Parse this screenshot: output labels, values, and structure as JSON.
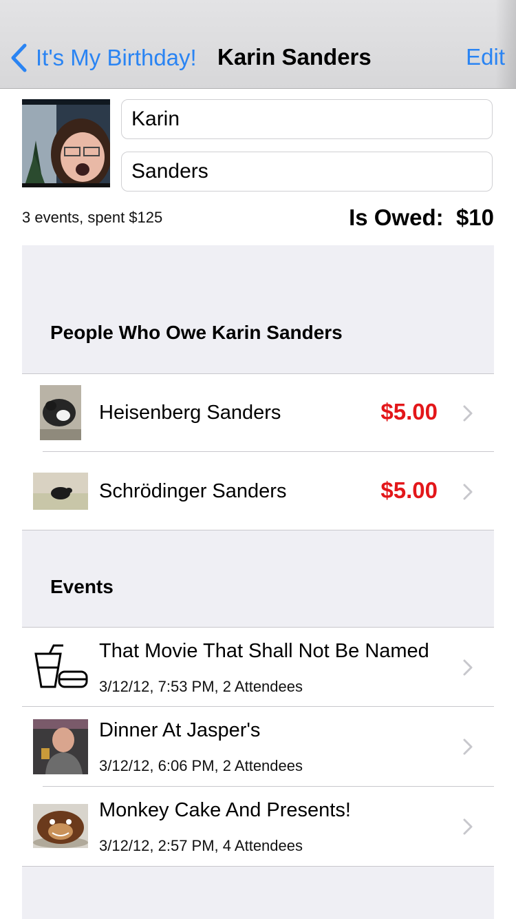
{
  "nav": {
    "back_label": "It's My Birthday!",
    "title": "Karin Sanders",
    "edit_label": "Edit"
  },
  "profile": {
    "first_name": "Karin",
    "last_name": "Sanders",
    "summary": "3 events, spent $125",
    "owed_label": "Is Owed:",
    "owed_amount": "$10"
  },
  "owe_section": {
    "header": "People Who Owe Karin Sanders",
    "people": [
      {
        "name": "Heisenberg Sanders",
        "amount": "$5.00"
      },
      {
        "name": "Schrödinger Sanders",
        "amount": "$5.00"
      }
    ]
  },
  "events_section": {
    "header": "Events",
    "events": [
      {
        "title": "That Movie That Shall Not Be Named",
        "details": "3/12/12, 7:53 PM, 2 Attendees"
      },
      {
        "title": "Dinner At Jasper's",
        "details": "3/12/12, 6:06 PM, 2 Attendees"
      },
      {
        "title": "Monkey Cake And Presents!",
        "details": "3/12/12, 2:57 PM, 4 Attendees"
      }
    ]
  },
  "colors": {
    "accent": "#2a84f3",
    "owed_amount": "#e3171a",
    "section_bg": "#efeff4"
  }
}
